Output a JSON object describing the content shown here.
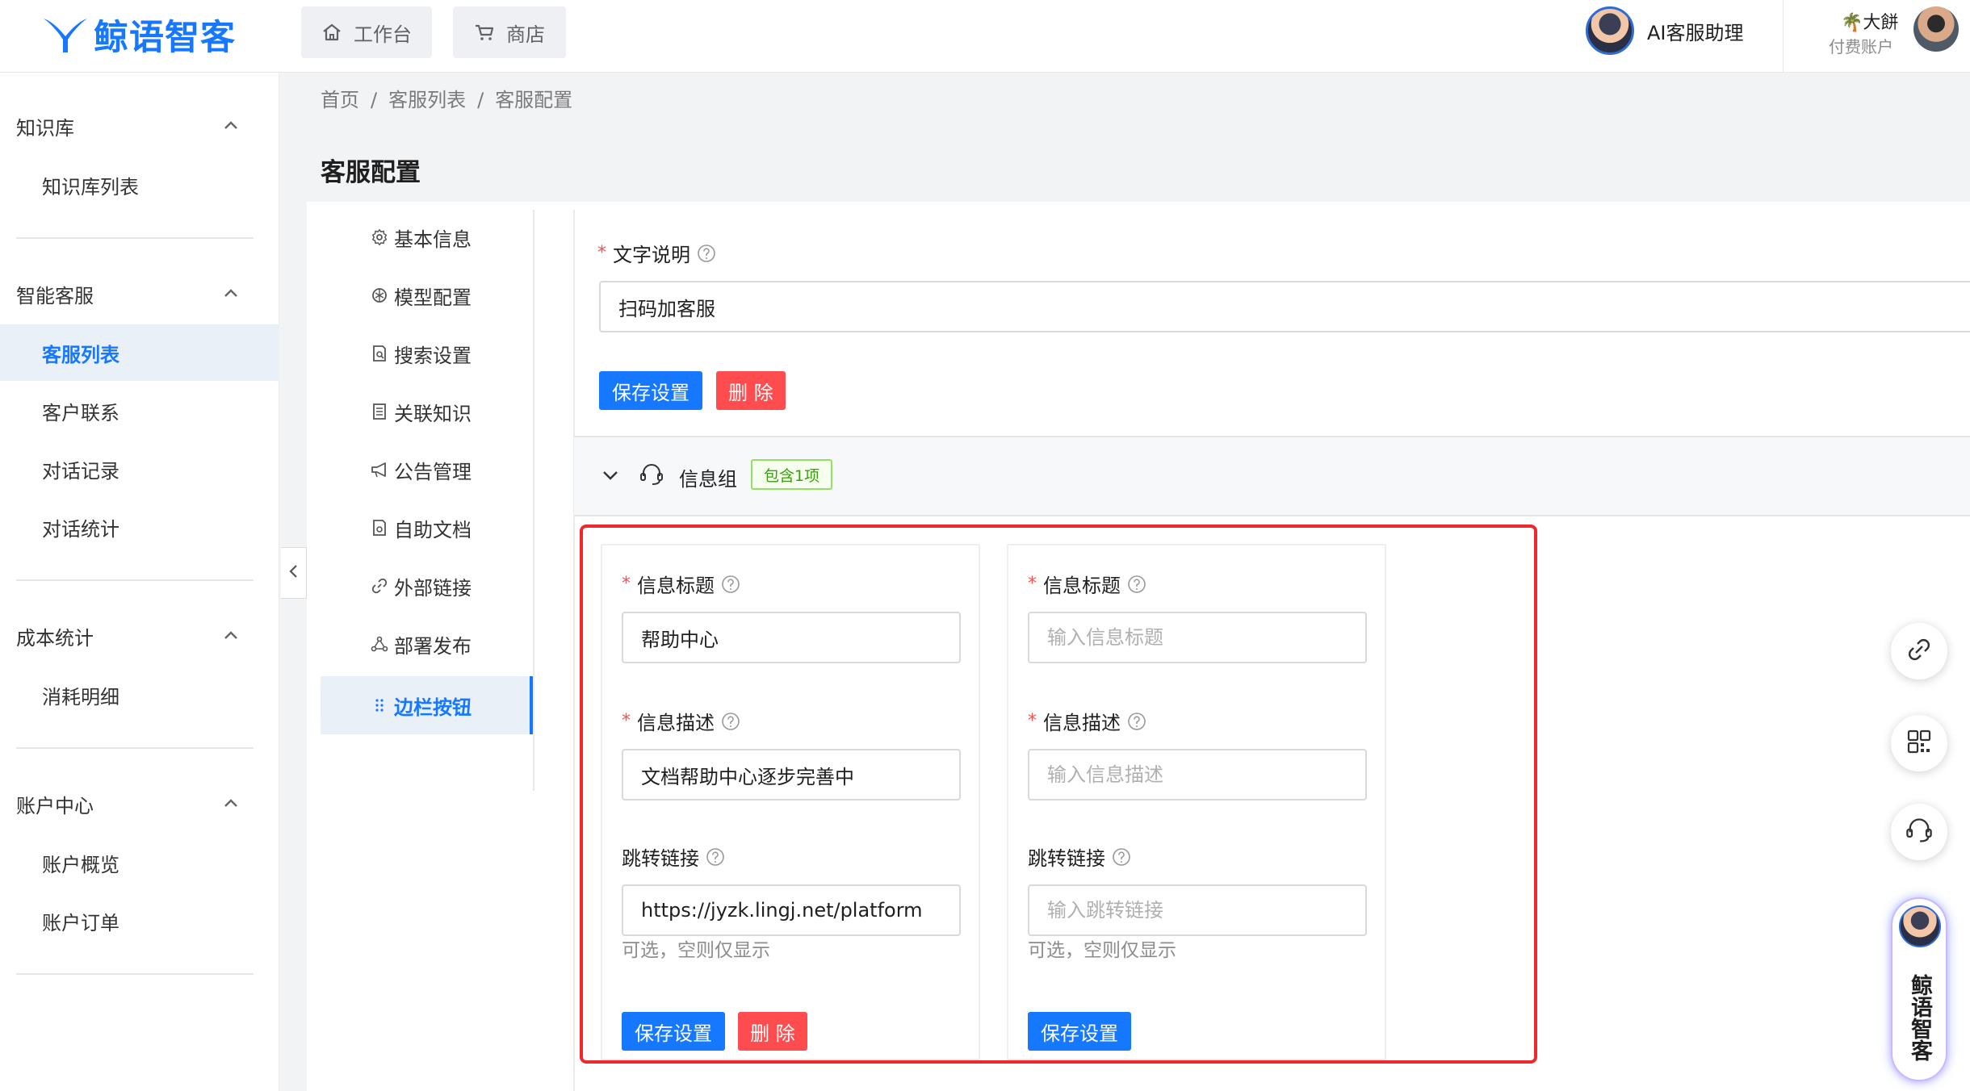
{
  "app": {
    "brand": "鲸语智客",
    "accent": "#1677ff",
    "danger": "#ff4d4f"
  },
  "topbar": {
    "tabs": [
      {
        "label": "工作台",
        "icon": "home-icon"
      },
      {
        "label": "商店",
        "icon": "cart-icon"
      }
    ],
    "assistant_label": "AI客服助理",
    "user_name": "大餅",
    "user_plan": "付费账户"
  },
  "sidebar": {
    "groups": [
      {
        "title": "知识库",
        "items": [
          "知识库列表"
        ]
      },
      {
        "title": "智能客服",
        "items": [
          "客服列表",
          "客户联系",
          "对话记录",
          "对话统计"
        ]
      },
      {
        "title": "成本统计",
        "items": [
          "消耗明细"
        ]
      },
      {
        "title": "账户中心",
        "items": [
          "账户概览",
          "账户订单"
        ]
      }
    ],
    "active_item": "客服列表"
  },
  "breadcrumb": [
    "首页",
    "客服列表",
    "客服配置"
  ],
  "breadcrumb_sep": "/",
  "page_title": "客服配置",
  "config_menu": {
    "items": [
      {
        "label": "基本信息",
        "icon": "gear-icon"
      },
      {
        "label": "模型配置",
        "icon": "openai-icon"
      },
      {
        "label": "搜索设置",
        "icon": "search-doc-icon"
      },
      {
        "label": "关联知识",
        "icon": "book-icon"
      },
      {
        "label": "公告管理",
        "icon": "megaphone-icon"
      },
      {
        "label": "自助文档",
        "icon": "doc-icon"
      },
      {
        "label": "外部链接",
        "icon": "link-icon"
      },
      {
        "label": "部署发布",
        "icon": "deploy-icon"
      },
      {
        "label": "边栏按钮",
        "icon": "drag-dots-icon"
      }
    ],
    "active": "边栏按钮"
  },
  "text_section": {
    "label": "文字说明",
    "value": "扫码加客服",
    "save_label": "保存设置",
    "delete_label": "删 除"
  },
  "info_group": {
    "title": "信息组",
    "badge": "包含1项",
    "cards": [
      {
        "title_label": "信息标题",
        "title_value": "帮助中心",
        "title_placeholder": "输入信息标题",
        "desc_label": "信息描述",
        "desc_value": "文档帮助中心逐步完善中",
        "desc_placeholder": "输入信息描述",
        "link_label": "跳转链接",
        "link_value": "https://jyzk.lingj.net/platform",
        "link_placeholder": "输入跳转链接",
        "hint": "可选，空则仅显示",
        "save_label": "保存设置",
        "delete_label": "删 除"
      },
      {
        "title_label": "信息标题",
        "title_value": "",
        "title_placeholder": "输入信息标题",
        "desc_label": "信息描述",
        "desc_value": "",
        "desc_placeholder": "输入信息描述",
        "link_label": "跳转链接",
        "link_value": "",
        "link_placeholder": "输入跳转链接",
        "hint": "可选，空则仅显示",
        "save_label": "保存设置"
      }
    ]
  },
  "floating": {
    "buttons": [
      "link-icon",
      "qrcode-icon",
      "headset-icon"
    ],
    "brand_vertical": "鲸语智客"
  }
}
